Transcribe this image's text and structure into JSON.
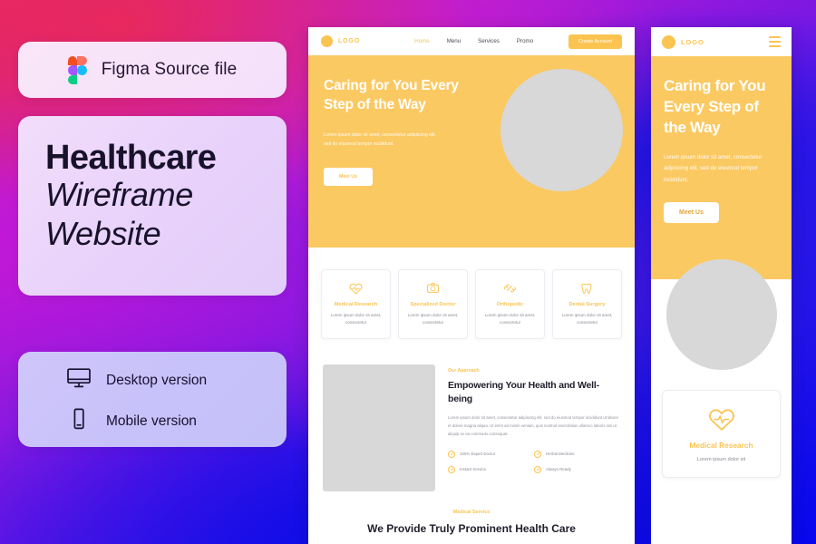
{
  "left_panel": {
    "figma_card": {
      "icon": "figma-logo-icon",
      "label": "Figma Source file"
    },
    "title_card": {
      "line_bold": "Healthcare",
      "line_italic_1": "Wireframe",
      "line_italic_2": "Website"
    },
    "version_card": {
      "items": [
        {
          "icon": "desktop-monitor-icon",
          "label": "Desktop version"
        },
        {
          "icon": "mobile-phone-icon",
          "label": "Mobile version"
        }
      ]
    }
  },
  "desktop_mockup": {
    "nav": {
      "logo_text": "LOGO",
      "links": [
        "Home",
        "Menu",
        "Services",
        "Promo"
      ],
      "active_link": "Home",
      "cta_label": "Create Account"
    },
    "hero": {
      "heading": "Caring for You Every Step of the Way",
      "subtext": "Lorem ipsum dolor sit amet, consectetur adipiscing elit, sed do eiusmod tempor incididunt.",
      "button_label": "Meet Us"
    },
    "service_cards": [
      {
        "icon": "heart-pulse-icon",
        "title": "Medical Research",
        "desc": "Lorem ipsum dolor sit amet, consectetur"
      },
      {
        "icon": "stethoscope-icon",
        "title": "Specialized Doctor",
        "desc": "Lorem ipsum dolor sit amet, consectetur"
      },
      {
        "icon": "bone-icon",
        "title": "Orthopedic",
        "desc": "Lorem ipsum dolor sit amet, consectetur"
      },
      {
        "icon": "tooth-icon",
        "title": "Dental Surgery",
        "desc": "Lorem ipsum dolor sit amet, consectetur"
      }
    ],
    "approach": {
      "eyebrow": "Our Approach",
      "heading": "Empowering Your Health and Well-being",
      "paragraph": "Lorem ipsum dolor sit amet, consectetur adipiscing elit, sed do eiusmod tempor incididunt ut labore et dolore magna aliqua. Ut enim ad minim veniam, quis nostrud exercitation ullamco laboris nisi ut aliquip ex ea commodo consequat.",
      "checks": [
        "100% Expert Doctor",
        "Herbal Medicine",
        "Instant Service",
        "Always Ready"
      ]
    },
    "bottom": {
      "eyebrow": "Medical Service",
      "heading": "We Provide Truly Prominent Health Care"
    }
  },
  "mobile_mockup": {
    "nav": {
      "logo_text": "LOGO",
      "menu_icon": "hamburger-menu-icon"
    },
    "hero": {
      "heading": "Caring for You Every Step of the Way",
      "subtext": "Lorem ipsum dolor sit amet, consectetur adipiscing elit, sed do eiusmod tempor incididunt.",
      "button_label": "Meet Us"
    },
    "card": {
      "icon": "heart-pulse-icon",
      "title": "Medical Research",
      "desc": "Lorem ipsum dolor sit"
    }
  },
  "colors": {
    "accent_yellow": "#fbc451",
    "hero_yellow": "#fbc962",
    "placeholder_gray": "#d8d8d8",
    "dark_text": "#20202e"
  }
}
